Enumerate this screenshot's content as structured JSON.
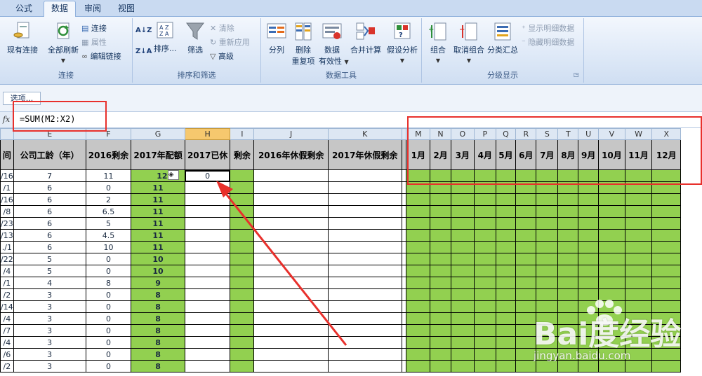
{
  "tabs": [
    "公式",
    "数据",
    "审阅",
    "视图"
  ],
  "active_tab": "数据",
  "ribbon": {
    "connections": {
      "existing": "现有连接",
      "refresh_all": "全部刷新",
      "connect": "连接",
      "properties": "属性",
      "edit_links": "编辑链接",
      "label": "连接"
    },
    "sort_filter": {
      "sort": "排序...",
      "filter": "筛选",
      "clear": "清除",
      "reapply": "重新应用",
      "advanced": "高级",
      "label": "排序和筛选"
    },
    "data_tools": {
      "split": "分列",
      "remove_dup_1": "删除",
      "remove_dup_2": "重复项",
      "validation_1": "数据",
      "validation_2": "有效性",
      "consolidate": "合并计算",
      "what_if": "假设分析",
      "label": "数据工具"
    },
    "outline": {
      "group": "组合",
      "ungroup": "取消组合",
      "subtotal": "分类汇总",
      "show_detail": "显示明细数据",
      "hide_detail": "隐藏明细数据",
      "label": "分级显示"
    }
  },
  "options_button": "选项...",
  "formula_bar": {
    "fx": "fx",
    "formula": "=SUM(M2:X2)"
  },
  "sheet": {
    "col_letters": [
      "E",
      "F",
      "G",
      "H",
      "I",
      "J",
      "K",
      "M",
      "N",
      "O",
      "P",
      "Q",
      "R",
      "S",
      "T",
      "U",
      "V",
      "W",
      "X"
    ],
    "headers": {
      "partial": "间",
      "tenure": "公司工龄（年）",
      "left2016": "2016剩余",
      "quota2017": "2017年配额",
      "used2017": "2017已休",
      "remaining": "剩余",
      "hol2016": "2016年休假剩余",
      "hol2017": "2017年休假剩余",
      "months": [
        "1月",
        "2月",
        "3月",
        "4月",
        "5月",
        "6月",
        "7月",
        "8月",
        "9月",
        "10月",
        "11月",
        "12月"
      ]
    },
    "rows": [
      {
        "d": "/16",
        "e": "7",
        "f": "11",
        "g": "12",
        "h": "0"
      },
      {
        "d": "/1",
        "e": "6",
        "f": "0",
        "g": "11",
        "h": ""
      },
      {
        "d": "/16",
        "e": "6",
        "f": "2",
        "g": "11",
        "h": ""
      },
      {
        "d": "/8",
        "e": "6",
        "f": "6.5",
        "g": "11",
        "h": ""
      },
      {
        "d": "/23",
        "e": "6",
        "f": "5",
        "g": "11",
        "h": ""
      },
      {
        "d": "/13",
        "e": "6",
        "f": "4.5",
        "g": "11",
        "h": ""
      },
      {
        "d": "./1",
        "e": "6",
        "f": "10",
        "g": "11",
        "h": ""
      },
      {
        "d": "/22",
        "e": "5",
        "f": "0",
        "g": "10",
        "h": ""
      },
      {
        "d": "/4",
        "e": "5",
        "f": "0",
        "g": "10",
        "h": ""
      },
      {
        "d": "/1",
        "e": "4",
        "f": "8",
        "g": "9",
        "h": ""
      },
      {
        "d": "/2",
        "e": "3",
        "f": "0",
        "g": "8",
        "h": ""
      },
      {
        "d": "/14",
        "e": "3",
        "f": "0",
        "g": "8",
        "h": ""
      },
      {
        "d": "/4",
        "e": "3",
        "f": "0",
        "g": "8",
        "h": ""
      },
      {
        "d": "/7",
        "e": "3",
        "f": "0",
        "g": "8",
        "h": ""
      },
      {
        "d": "/4",
        "e": "3",
        "f": "0",
        "g": "8",
        "h": ""
      },
      {
        "d": "/6",
        "e": "3",
        "f": "0",
        "g": "8",
        "h": ""
      },
      {
        "d": "/2",
        "e": "3",
        "f": "0",
        "g": "8",
        "h": ""
      }
    ]
  },
  "watermark": {
    "logo": "Bai度经验",
    "url": "jingyan.baidu.com"
  },
  "colors": {
    "green_fill": "#92d050",
    "header_gray": "#c6c6c6",
    "annotation_red": "#e8302c"
  }
}
